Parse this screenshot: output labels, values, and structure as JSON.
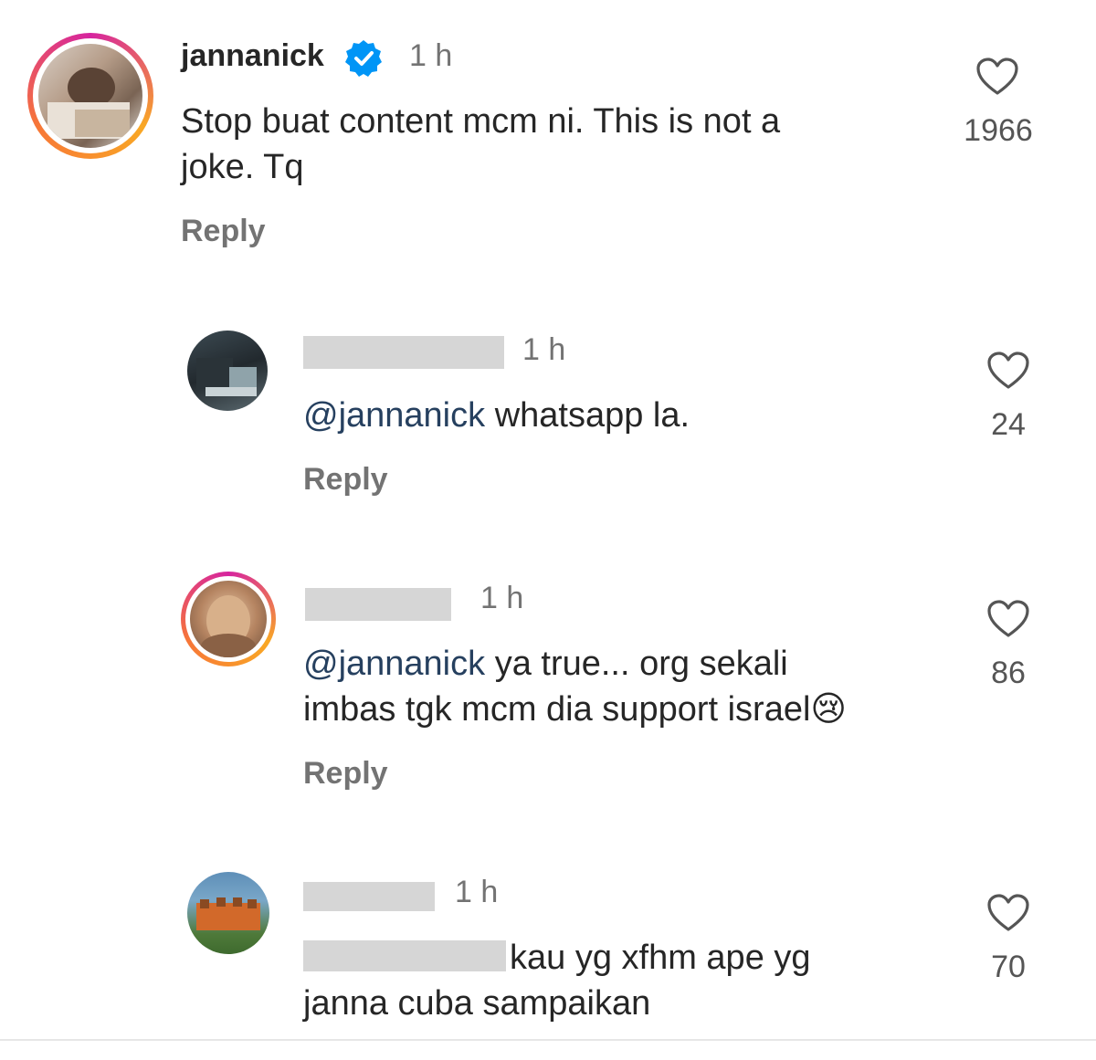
{
  "comments": [
    {
      "username": "jannanick",
      "time": "1 h",
      "text_lines": [
        "Stop buat content mcm ni. This is not a",
        "joke. Tq"
      ],
      "reply_label": "Reply",
      "likes": "1966"
    },
    {
      "time": "1 h",
      "mention": "@jannanick",
      "text": " whatsapp la.",
      "reply_label": "Reply",
      "likes": "24"
    },
    {
      "time": "1 h",
      "mention": "@jannanick",
      "text_line1": " ya true... org sekali",
      "text_line2": "imbas tgk mcm dia support israel",
      "emoji": "😢",
      "reply_label": "Reply",
      "likes": "86"
    },
    {
      "time": "1 h",
      "text_line1": " kau yg xfhm ape yg",
      "text_line2": "janna cuba sampaikan",
      "likes": "70"
    }
  ],
  "colors": {
    "verified": "#0095f6",
    "story_ring_start": "#f9a825",
    "story_ring_end": "#d6249f"
  },
  "icons": {
    "like": "heart-outline-icon",
    "verified": "verified-badge-icon"
  }
}
